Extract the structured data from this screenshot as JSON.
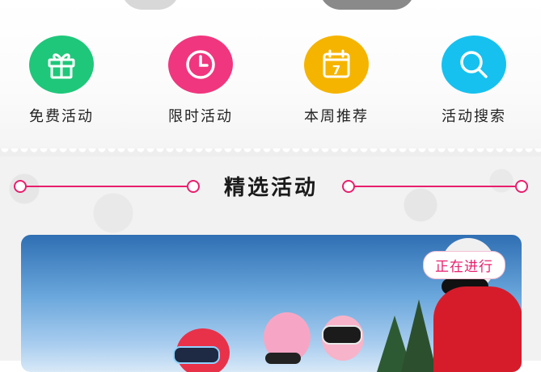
{
  "categories": [
    {
      "label": "免费活动",
      "icon": "gift-icon",
      "color": "#1fc77a"
    },
    {
      "label": "限时活动",
      "icon": "clock-icon",
      "color": "#f0367e"
    },
    {
      "label": "本周推荐",
      "icon": "calendar-icon",
      "color": "#f5b400",
      "icon_text": "7"
    },
    {
      "label": "活动搜索",
      "icon": "search-icon",
      "color": "#16c1ef"
    }
  ],
  "featured": {
    "title": "精选活动",
    "accent": "#e91e6e"
  },
  "card": {
    "badge": "正在进行"
  }
}
